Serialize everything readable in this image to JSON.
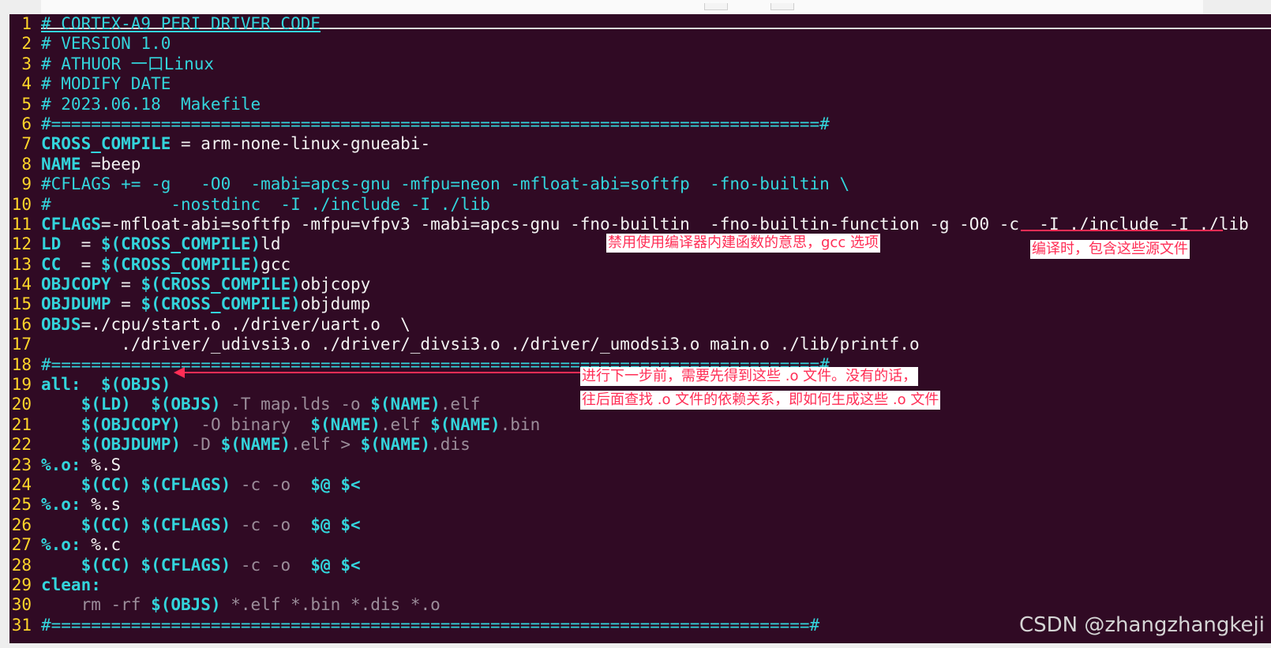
{
  "editor": {
    "lines": [
      {
        "n": "1",
        "segs": [
          {
            "c": "cyan ul",
            "t": "# CORTEX-A9 PERI DRIVER CODE"
          }
        ]
      },
      {
        "n": "2",
        "segs": [
          {
            "c": "cyan",
            "t": "# VERSION 1.0"
          }
        ]
      },
      {
        "n": "3",
        "segs": [
          {
            "c": "cyan",
            "t": "# ATHUOR 一口Linux"
          }
        ]
      },
      {
        "n": "4",
        "segs": [
          {
            "c": "cyan",
            "t": "# MODIFY DATE"
          }
        ]
      },
      {
        "n": "5",
        "segs": [
          {
            "c": "cyan",
            "t": "# 2023.06.18  Makefile"
          }
        ]
      },
      {
        "n": "6",
        "segs": [
          {
            "c": "cyan",
            "t": "#=============================================================================#"
          }
        ]
      },
      {
        "n": "7",
        "segs": [
          {
            "c": "cyanb",
            "t": "CROSS_COMPILE"
          },
          {
            "c": "code",
            "t": " = arm-none-linux-gnueabi-"
          }
        ]
      },
      {
        "n": "8",
        "segs": [
          {
            "c": "cyanb",
            "t": "NAME"
          },
          {
            "c": "code",
            "t": " =beep"
          }
        ]
      },
      {
        "n": "9",
        "segs": [
          {
            "c": "cyan",
            "t": "#CFLAGS += -g   -O0  -mabi=apcs-gnu -mfpu=neon -mfloat-abi=softfp  -fno-builtin \\"
          }
        ]
      },
      {
        "n": "10",
        "segs": [
          {
            "c": "cyan",
            "t": "#            -nostdinc  -I ./include -I ./lib"
          }
        ]
      },
      {
        "n": "11",
        "segs": [
          {
            "c": "cyanb",
            "t": "CFLAGS"
          },
          {
            "c": "code",
            "t": "=-mfloat-abi=softfp -mfpu=vfpv3 -mabi=apcs-gnu -fno-builtin  -fno-builtin-function -g -O0 -c  -I ./include -I ./lib"
          }
        ]
      },
      {
        "n": "12",
        "segs": [
          {
            "c": "cyanb",
            "t": "LD"
          },
          {
            "c": "code",
            "t": "  = "
          },
          {
            "c": "cyanb",
            "t": "$(CROSS_COMPILE)"
          },
          {
            "c": "code",
            "t": "ld"
          }
        ]
      },
      {
        "n": "13",
        "segs": [
          {
            "c": "cyanb",
            "t": "CC"
          },
          {
            "c": "code",
            "t": "  = "
          },
          {
            "c": "cyanb",
            "t": "$(CROSS_COMPILE)"
          },
          {
            "c": "code",
            "t": "gcc"
          }
        ]
      },
      {
        "n": "14",
        "segs": [
          {
            "c": "cyanb",
            "t": "OBJCOPY"
          },
          {
            "c": "code",
            "t": " = "
          },
          {
            "c": "cyanb",
            "t": "$(CROSS_COMPILE)"
          },
          {
            "c": "code",
            "t": "objcopy"
          }
        ]
      },
      {
        "n": "15",
        "segs": [
          {
            "c": "cyanb",
            "t": "OBJDUMP"
          },
          {
            "c": "code",
            "t": " = "
          },
          {
            "c": "cyanb",
            "t": "$(CROSS_COMPILE)"
          },
          {
            "c": "code",
            "t": "objdump"
          }
        ]
      },
      {
        "n": "16",
        "segs": [
          {
            "c": "cyanb",
            "t": "OBJS"
          },
          {
            "c": "code",
            "t": "=./cpu/start.o ./driver/uart.o  \\"
          }
        ]
      },
      {
        "n": "17",
        "segs": [
          {
            "c": "code",
            "t": "        ./driver/_udivsi3.o ./driver/_divsi3.o ./driver/_umodsi3.o main.o ./lib/printf.o"
          }
        ]
      },
      {
        "n": "18",
        "segs": [
          {
            "c": "cyan",
            "t": "#=============================================================================#"
          }
        ]
      },
      {
        "n": "19",
        "segs": [
          {
            "c": "cyanb",
            "t": "all:"
          },
          {
            "c": "code",
            "t": "  "
          },
          {
            "c": "cyanb",
            "t": "$(OBJS)"
          }
        ]
      },
      {
        "n": "20",
        "segs": [
          {
            "c": "code",
            "t": "    "
          },
          {
            "c": "cyanb",
            "t": "$(LD)"
          },
          {
            "c": "code",
            "t": "  "
          },
          {
            "c": "cyanb",
            "t": "$(OBJS)"
          },
          {
            "c": "dim",
            "t": " -T map.lds -o "
          },
          {
            "c": "cyanb",
            "t": "$(NAME)"
          },
          {
            "c": "dim",
            "t": ".elf"
          }
        ]
      },
      {
        "n": "21",
        "segs": [
          {
            "c": "code",
            "t": "    "
          },
          {
            "c": "cyanb",
            "t": "$(OBJCOPY)"
          },
          {
            "c": "dim",
            "t": "  -O binary  "
          },
          {
            "c": "cyanb",
            "t": "$(NAME)"
          },
          {
            "c": "dim",
            "t": ".elf "
          },
          {
            "c": "cyanb",
            "t": "$(NAME)"
          },
          {
            "c": "dim",
            "t": ".bin"
          }
        ]
      },
      {
        "n": "22",
        "segs": [
          {
            "c": "code",
            "t": "    "
          },
          {
            "c": "cyanb",
            "t": "$(OBJDUMP)"
          },
          {
            "c": "dim",
            "t": " -D "
          },
          {
            "c": "cyanb",
            "t": "$(NAME)"
          },
          {
            "c": "dim",
            "t": ".elf > "
          },
          {
            "c": "cyanb",
            "t": "$(NAME)"
          },
          {
            "c": "dim",
            "t": ".dis"
          }
        ]
      },
      {
        "n": "23",
        "segs": [
          {
            "c": "cyanb",
            "t": "%.o:"
          },
          {
            "c": "code",
            "t": " %.S"
          }
        ]
      },
      {
        "n": "24",
        "segs": [
          {
            "c": "code",
            "t": "    "
          },
          {
            "c": "cyanb",
            "t": "$(CC) $(CFLAGS)"
          },
          {
            "c": "dim",
            "t": " -c -o  "
          },
          {
            "c": "cyanb",
            "t": "$@ $<"
          }
        ]
      },
      {
        "n": "25",
        "segs": [
          {
            "c": "cyanb",
            "t": "%.o:"
          },
          {
            "c": "code",
            "t": " %.s"
          }
        ]
      },
      {
        "n": "26",
        "segs": [
          {
            "c": "code",
            "t": "    "
          },
          {
            "c": "cyanb",
            "t": "$(CC) $(CFLAGS)"
          },
          {
            "c": "dim",
            "t": " -c -o  "
          },
          {
            "c": "cyanb",
            "t": "$@ $<"
          }
        ]
      },
      {
        "n": "27",
        "segs": [
          {
            "c": "cyanb",
            "t": "%.o:"
          },
          {
            "c": "code",
            "t": " %.c"
          }
        ]
      },
      {
        "n": "28",
        "segs": [
          {
            "c": "code",
            "t": "    "
          },
          {
            "c": "cyanb",
            "t": "$(CC) $(CFLAGS)"
          },
          {
            "c": "dim",
            "t": " -c -o  "
          },
          {
            "c": "cyanb",
            "t": "$@ $<"
          }
        ]
      },
      {
        "n": "29",
        "segs": [
          {
            "c": "cyanb",
            "t": "clean:"
          }
        ]
      },
      {
        "n": "30",
        "segs": [
          {
            "c": "code",
            "t": "    "
          },
          {
            "c": "dim",
            "t": "rm -rf "
          },
          {
            "c": "cyanb",
            "t": "$(OBJS)"
          },
          {
            "c": "dim",
            "t": " *.elf *.bin *.dis *.o"
          }
        ]
      },
      {
        "n": "31",
        "segs": [
          {
            "c": "cyan",
            "t": "#============================================================================#"
          }
        ]
      }
    ]
  },
  "annotations": {
    "builtin_note": "禁用使用编译器内建函数的意思，gcc 选项",
    "include_note": "编译时，包含这些源文件",
    "objs_note_1": "进行下一步前，需要先得到这些 .o 文件。没有的话，",
    "objs_note_2": "往后面查找 .o 文件的依赖关系，即如何生成这些 .o 文件"
  },
  "watermark": "CSDN @zhangzhangkeji",
  "colors": {
    "background": "#300a24",
    "line_number": "#ffd52a",
    "keyword": "#33d5dc",
    "annotation": "#ff2d55"
  }
}
